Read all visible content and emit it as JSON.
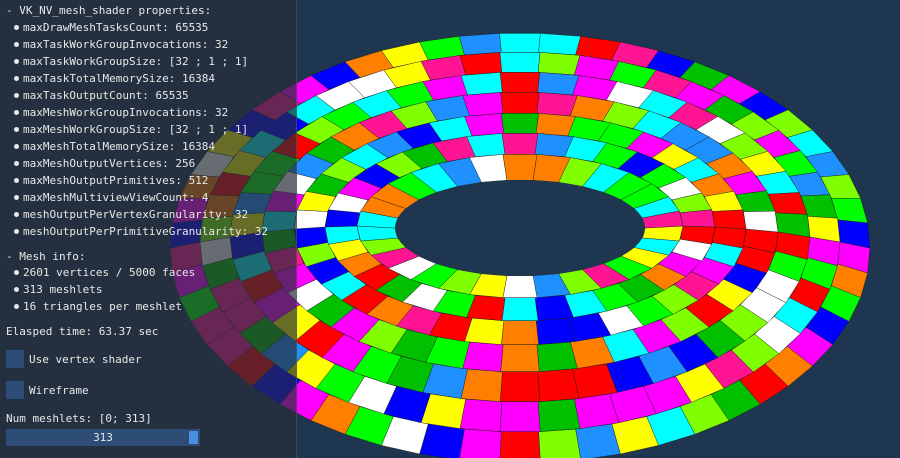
{
  "properties": {
    "header": "- VK_NV_mesh_shader properties:",
    "items": [
      "maxDrawMeshTasksCount: 65535",
      "maxTaskWorkGroupInvocations: 32",
      "maxTaskWorkGroupSize: [32 ; 1 ; 1]",
      "maxTaskTotalMemorySize: 16384",
      "maxTaskOutputCount: 65535",
      "maxMeshWorkGroupInvocations: 32",
      "maxMeshWorkGroupSize: [32 ; 1 ; 1]",
      "maxMeshTotalMemorySize: 16384",
      "maxMeshOutputVertices: 256",
      "maxMeshOutputPrimitives: 512",
      "maxMeshMultiviewViewCount: 4",
      "meshOutputPerVertexGranularity: 32",
      "meshOutputPerPrimitiveGranularity: 32"
    ]
  },
  "mesh_info": {
    "header": "- Mesh info:",
    "items": [
      "2601 vertices / 5000 faces",
      "313 meshlets",
      "16 triangles per meshlet"
    ]
  },
  "elapsed": "Elasped time: 63.37 sec",
  "controls": {
    "use_vertex_shader": {
      "label": "Use vertex shader",
      "checked": false
    },
    "wireframe": {
      "label": "Wireframe",
      "checked": false
    },
    "num_meshlets": {
      "label": "Num meshlets: [0; 313]",
      "value": "313",
      "fraction": 1.0
    }
  },
  "colors": {
    "background": "#1f3650",
    "panel": "#262e38",
    "widget": "#2d4d76",
    "slider_grab": "#4a90e2",
    "meshlet_palette": [
      "#ff0000",
      "#00ff00",
      "#0000ff",
      "#ffff00",
      "#00ffff",
      "#ff00ff",
      "#ff8000",
      "#80ff00",
      "#ffffff",
      "#1e90ff",
      "#00c000",
      "#ff1493"
    ]
  }
}
